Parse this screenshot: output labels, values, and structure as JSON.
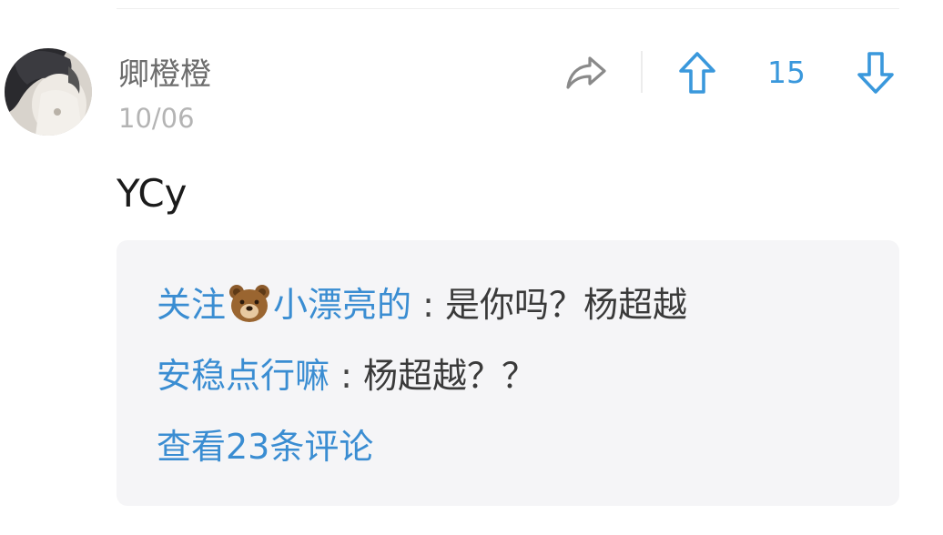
{
  "post": {
    "username": "卿橙橙",
    "date": "10/06",
    "content": "YCy",
    "vote_count": "15"
  },
  "replies": [
    {
      "author_prefix": "关注",
      "author_emoji": "bear-emoji",
      "author_suffix": "小漂亮的",
      "separator": ":",
      "text": "是你吗？杨超越"
    },
    {
      "author": "安稳点行嘛",
      "separator": ":",
      "text": "杨超越？？"
    }
  ],
  "view_all_label": "查看23条评论",
  "colors": {
    "accent": "#3a8dd2",
    "username": "#6d6d6d",
    "date": "#b4b4b4",
    "reply_bg": "#f5f5f7"
  },
  "icons": [
    "share-icon",
    "upvote-icon",
    "downvote-icon",
    "avatar-photo",
    "bear-emoji"
  ]
}
